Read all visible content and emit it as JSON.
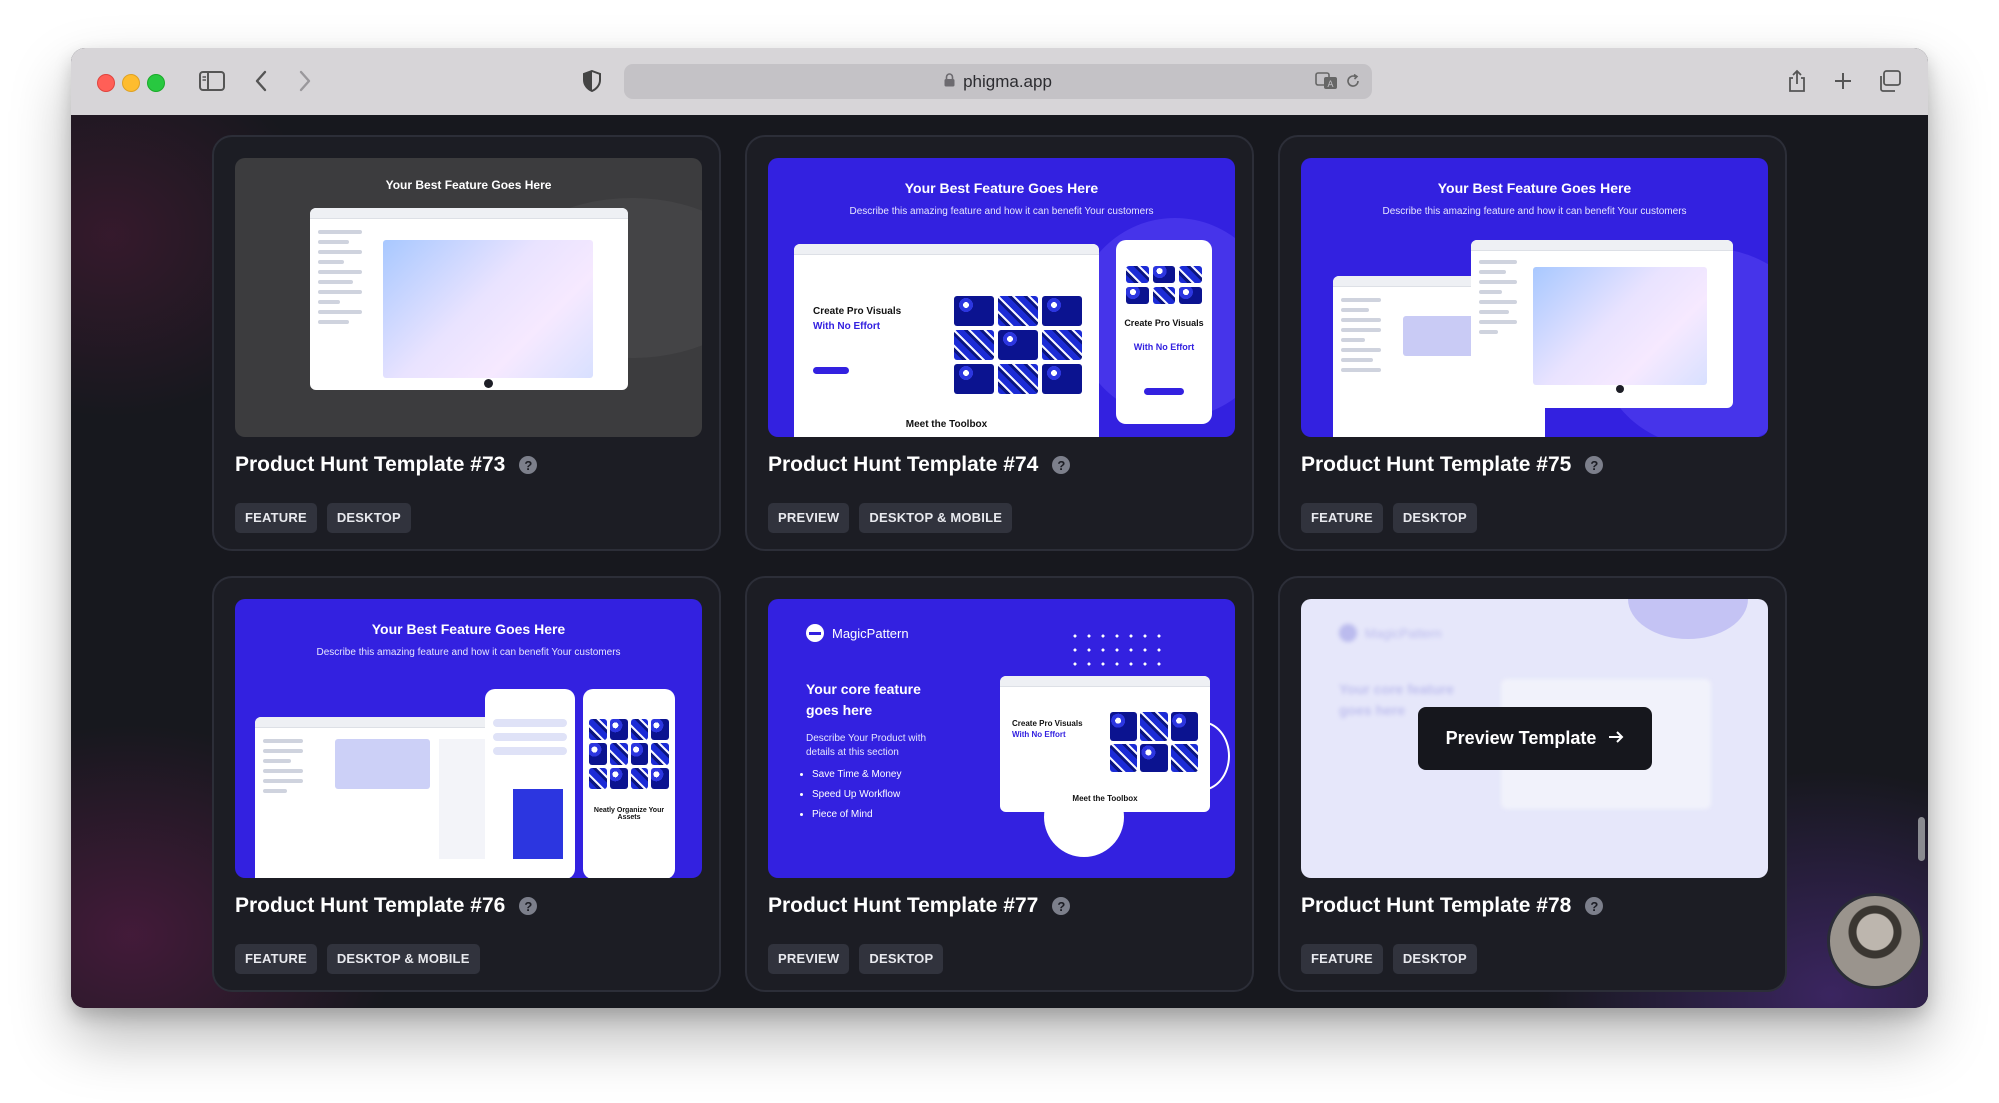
{
  "browser": {
    "url": "phigma.app"
  },
  "cards": [
    {
      "title": "Product Hunt Template #73",
      "tags": [
        "FEATURE",
        "DESKTOP"
      ],
      "thumb": {
        "headline": "Your Best Feature Goes Here"
      }
    },
    {
      "title": "Product Hunt Template #74",
      "tags": [
        "PREVIEW",
        "DESKTOP & MOBILE"
      ],
      "thumb": {
        "headline": "Your Best Feature Goes Here",
        "sub": "Describe this amazing feature and how it can benefit Your customers",
        "desktop_heading": "Create Pro Visuals",
        "desktop_heading_accent": "With No Effort",
        "mobile_heading": "Create Pro Visuals",
        "mobile_heading_accent": "With No Effort",
        "footer": "Meet the Toolbox"
      }
    },
    {
      "title": "Product Hunt Template #75",
      "tags": [
        "FEATURE",
        "DESKTOP"
      ],
      "thumb": {
        "headline": "Your Best Feature Goes Here",
        "sub": "Describe this amazing feature and how it can benefit Your customers"
      }
    },
    {
      "title": "Product Hunt Template #76",
      "tags": [
        "FEATURE",
        "DESKTOP & MOBILE"
      ],
      "thumb": {
        "headline": "Your Best Feature Goes Here",
        "sub": "Describe this amazing feature and how it can benefit Your customers",
        "phone_heading": "Neatly Organize Your Assets"
      }
    },
    {
      "title": "Product Hunt Template #77",
      "tags": [
        "PREVIEW",
        "DESKTOP"
      ],
      "thumb": {
        "brand": "MagicPattern",
        "headline": "Your core feature goes here",
        "sub": "Describe Your Product with details at this section",
        "bullets": [
          "Save Time & Money",
          "Speed Up Workflow",
          "Piece of Mind"
        ],
        "mock_heading": "Create Pro Visuals",
        "mock_heading_accent": "With No Effort",
        "mock_footer": "Meet the Toolbox"
      }
    },
    {
      "title": "Product Hunt Template #78",
      "tags": [
        "FEATURE",
        "DESKTOP"
      ],
      "thumb": {
        "brand": "MagicPattern",
        "headline": "Your core feature goes here"
      },
      "hover_button": "Preview Template"
    }
  ],
  "colors": {
    "brand_blue": "#3321e0",
    "page_bg": "#17181e",
    "card_bg": "#1c1d24",
    "tag_bg": "#31333d"
  },
  "icons": [
    "sidebar-icon",
    "back-icon",
    "forward-icon",
    "shield-icon",
    "lock-icon",
    "translate-icon",
    "reload-icon",
    "share-icon",
    "plus-icon",
    "tabs-icon",
    "help-icon",
    "arrow-right-icon"
  ]
}
